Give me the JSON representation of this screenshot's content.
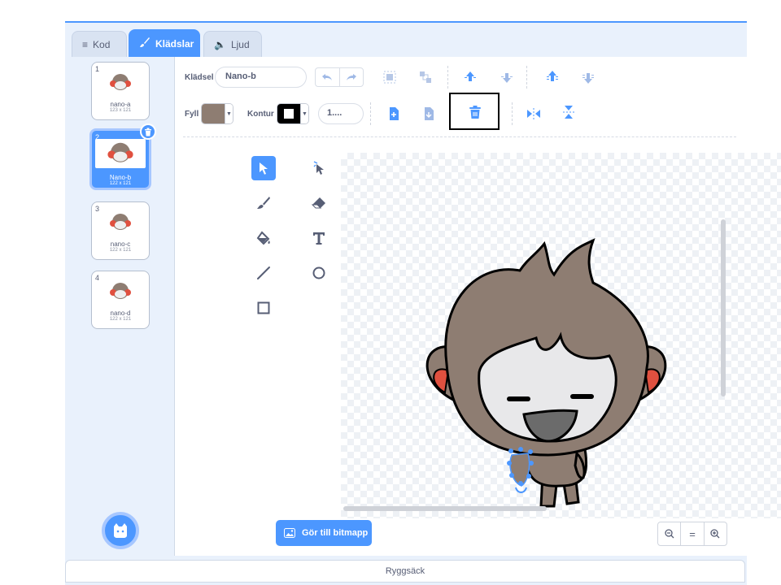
{
  "tabs": [
    {
      "label": "Kod",
      "icon": "code-icon",
      "active": false
    },
    {
      "label": "Klädslar",
      "icon": "paintbrush-icon",
      "active": true
    },
    {
      "label": "Ljud",
      "icon": "speaker-icon",
      "active": false
    }
  ],
  "costumes": [
    {
      "number": "1",
      "name": "nano-a",
      "size": "123 x 121",
      "selected": false
    },
    {
      "number": "2",
      "name": "Nano-b",
      "size": "122 x 121",
      "selected": true
    },
    {
      "number": "3",
      "name": "nano-c",
      "size": "122 x 121",
      "selected": false
    },
    {
      "number": "4",
      "name": "nano-d",
      "size": "122 x 121",
      "selected": false
    }
  ],
  "toolbar": {
    "costume_label": "Klädsel",
    "costume_name": "Nano-b",
    "fill_label": "Fyll",
    "fill_color": "#8e7d72",
    "outline_label": "Kontur",
    "outline_color": "#000000",
    "outline_width": "1....",
    "icons": [
      "undo-icon",
      "redo-icon",
      "group-icon",
      "ungroup-icon",
      "forward-icon",
      "backward-icon",
      "front-icon",
      "back-icon",
      "copy-icon",
      "paste-icon",
      "delete-icon",
      "flip-horizontal-icon",
      "flip-vertical-icon"
    ]
  },
  "tools": [
    "select-tool",
    "reshape-tool",
    "brush-tool",
    "eraser-tool",
    "fill-tool",
    "text-tool",
    "line-tool",
    "circle-tool",
    "rectangle-tool"
  ],
  "canvas": {
    "convert_button": "Gör till bitmapp"
  },
  "zoom": {
    "out": "−",
    "reset": "=",
    "in": "+"
  },
  "backpack_label": "Ryggsäck",
  "colors": {
    "accent": "#4c97ff",
    "character_brown": "#8e7d72",
    "ear_red": "#e0503f"
  }
}
